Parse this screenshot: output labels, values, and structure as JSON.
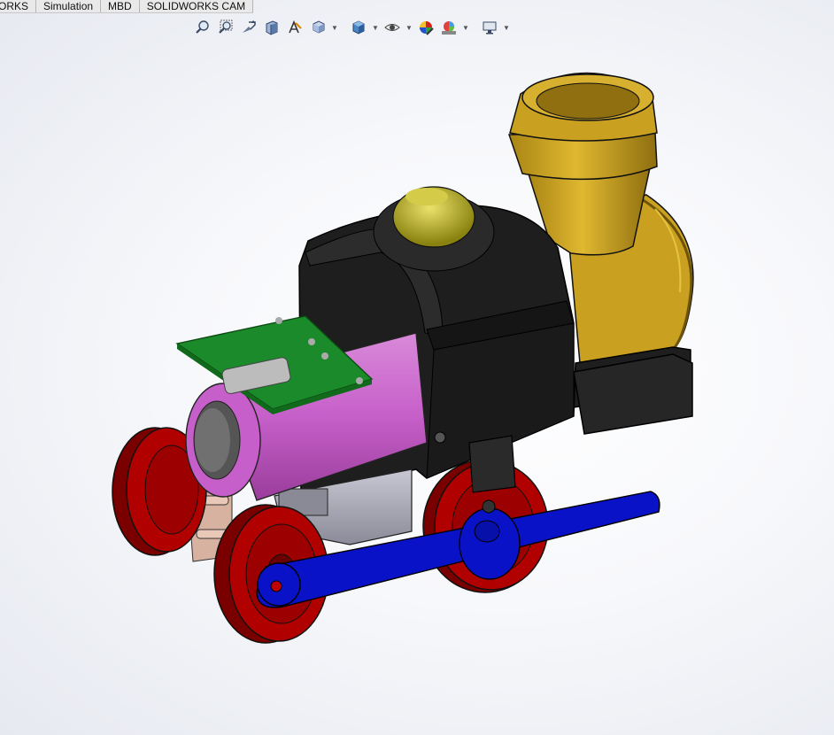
{
  "command_tabs": [
    {
      "label": "ORKS"
    },
    {
      "label": "Simulation"
    },
    {
      "label": "MBD"
    },
    {
      "label": "SOLIDWORKS CAM"
    }
  ],
  "heads_up_toolbar": {
    "buttons": [
      {
        "icon": "zoom-to-fit-icon"
      },
      {
        "icon": "zoom-to-area-icon"
      },
      {
        "icon": "previous-view-icon"
      },
      {
        "icon": "section-view-icon"
      },
      {
        "icon": "dynamic-annotation-view-icon"
      },
      {
        "icon": "view-orientation-icon",
        "has_dropdown": true
      },
      {
        "icon": "display-style-icon",
        "has_dropdown": true
      },
      {
        "icon": "hide-show-items-icon",
        "has_dropdown": true
      },
      {
        "icon": "edit-appearance-icon"
      },
      {
        "icon": "apply-scene-icon",
        "has_dropdown": true
      },
      {
        "icon": "view-settings-icon",
        "has_dropdown": true
      }
    ]
  },
  "model": {
    "name": "toy-steam-locomotive-assembly",
    "colors": {
      "wheels": "#b00000",
      "wheel_shadow": "#7a0000",
      "cab_body": "#1e1e1e",
      "smokestack": "#c9a020",
      "smokestack_dark": "#8f6f10",
      "boiler_barrel": "#c65fc9",
      "pcb": "#1a8a2a",
      "connecting_rod": "#0a12c8",
      "dome": "#b9b02a",
      "motor": "#a8a8b4",
      "copper_bracket": "#d8b2a0"
    }
  }
}
